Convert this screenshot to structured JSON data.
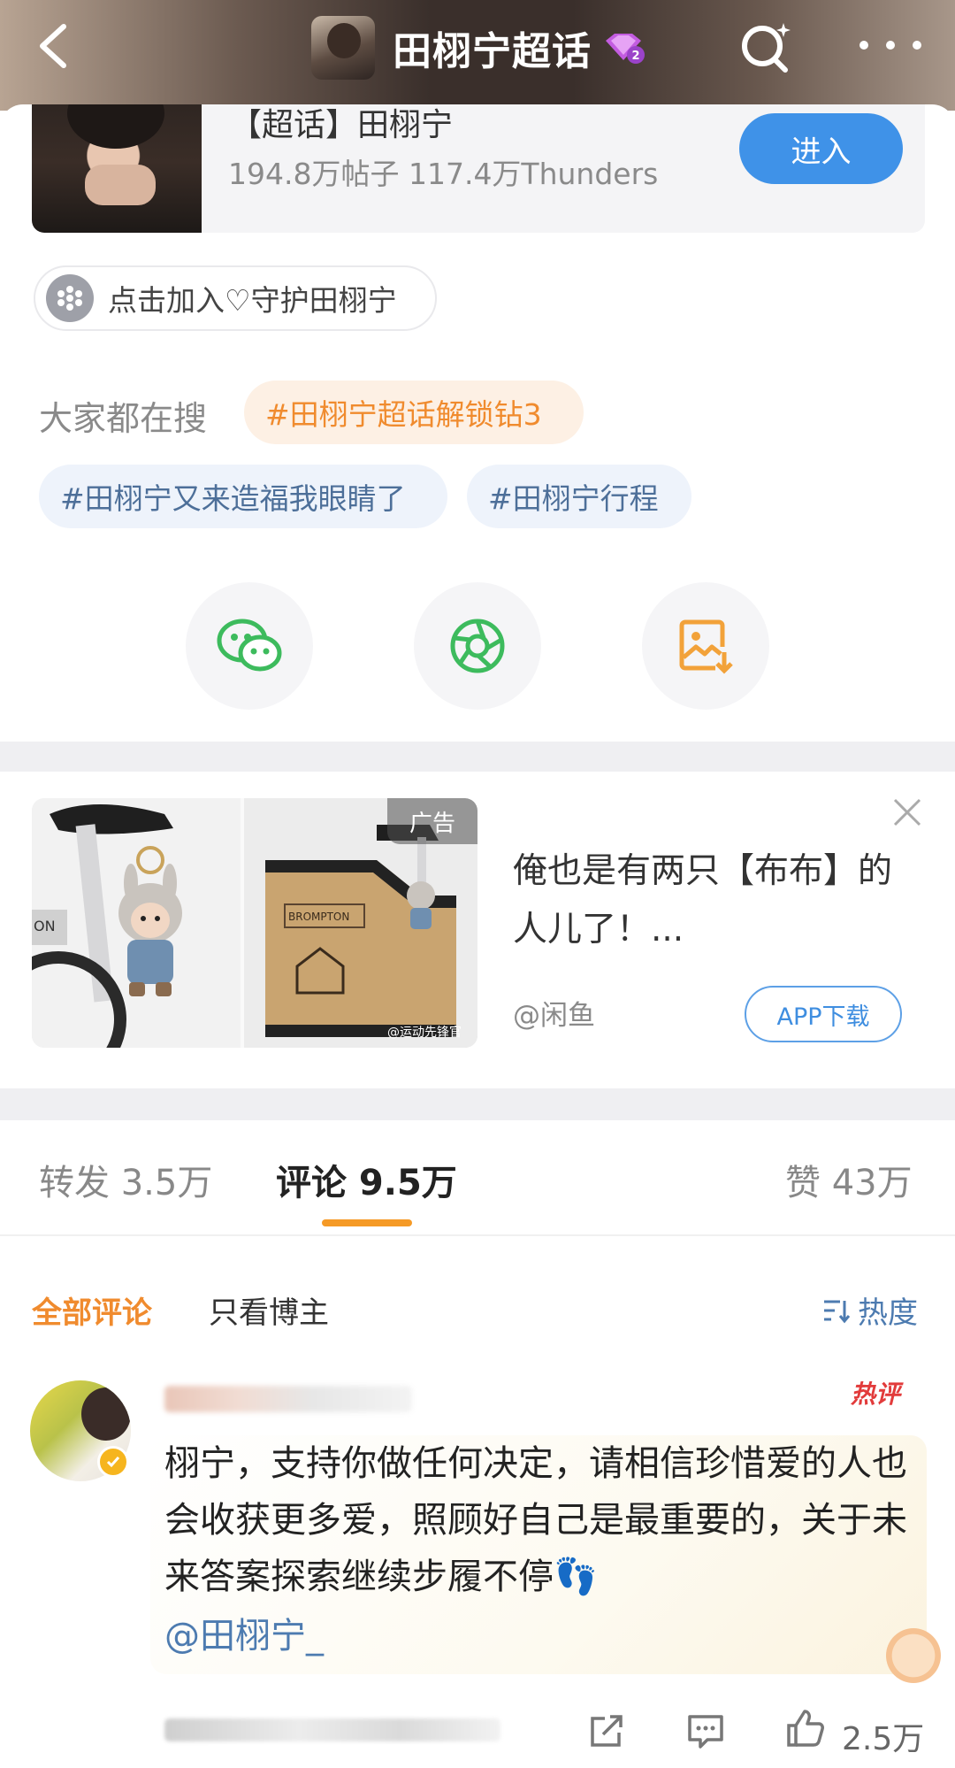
{
  "header": {
    "title": "田栩宁超话",
    "level_badge": "2"
  },
  "supertopic": {
    "name": "【超话】田栩宁",
    "stats": "194.8万帖子 117.4万Thunders",
    "enter_label": "进入"
  },
  "guard": {
    "label": "点击加入♡守护田栩宁"
  },
  "trending": {
    "label": "大家都在搜",
    "tags": [
      "#田栩宁超话解锁钻3",
      "#田栩宁又来造福我眼睛了",
      "#田栩宁行程"
    ]
  },
  "share": {
    "items": [
      "wechat-icon",
      "moments-icon",
      "save-image-icon"
    ]
  },
  "ad": {
    "badge": "广告",
    "image_box_label": "BROMPTON",
    "watermark": "@运动先锋官",
    "title": "俺也是有两只【布布】的人儿了！...",
    "source": "@闲鱼",
    "cta": "APP下载"
  },
  "tabs": {
    "repost": "转发 3.5万",
    "comment": "评论 9.5万",
    "like": "赞 43万"
  },
  "filters": {
    "all": "全部评论",
    "owner_only": "只看博主",
    "sort": "热度"
  },
  "comment": {
    "hot_label": "热评",
    "text": "栩宁，支持你做任何决定，请相信珍惜爱的人也会收获更多爱，照顾好自己是最重要的，关于未来答案探索继续步履不停👣",
    "mention": "@田栩宁_",
    "like_count": "2.5万"
  },
  "colors": {
    "accent_orange": "#f08b2e",
    "link_blue": "#4d7bb0",
    "button_blue": "#3f92e8",
    "hot_red": "#e23b3b"
  }
}
